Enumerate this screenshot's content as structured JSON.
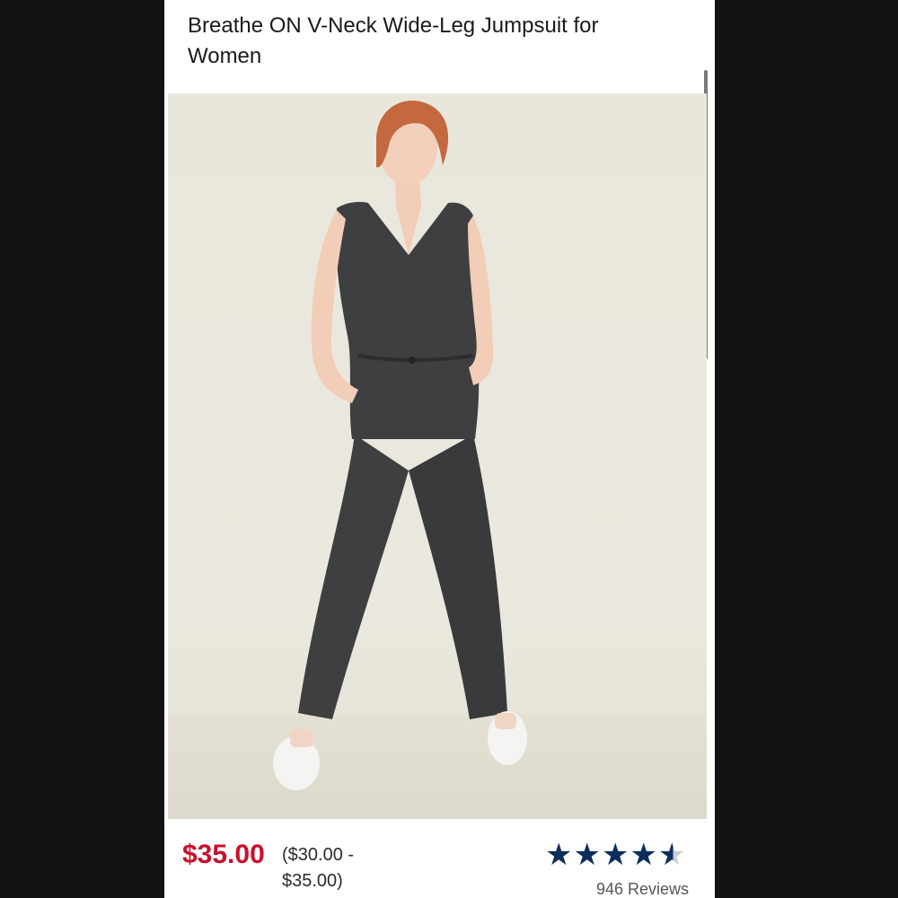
{
  "product": {
    "title": "Breathe ON V-Neck Wide-Leg Jumpsuit for Women",
    "image_icon": "product-photo",
    "price": "$35.00",
    "price_range": "($30.00 - $35.00)",
    "rating": 4.5,
    "rating_max": 5,
    "reviews": "946 Reviews"
  },
  "carousel": {
    "current_slide_fraction": 0.11
  },
  "colors": {
    "price": "#c8102e",
    "star": "#0d2d5a",
    "jumpsuit": "#3e3f41",
    "hair": "#c4683f"
  }
}
